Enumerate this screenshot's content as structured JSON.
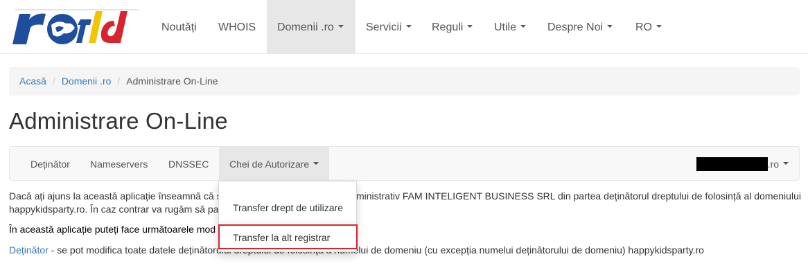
{
  "navbar": {
    "logo_text": "rotld",
    "items": [
      {
        "label": "Noutăți",
        "dropdown": false
      },
      {
        "label": "WHOIS",
        "dropdown": false
      },
      {
        "label": "Domenii .ro",
        "dropdown": true,
        "active": true
      },
      {
        "label": "Servicii",
        "dropdown": true
      },
      {
        "label": "Reguli",
        "dropdown": true
      },
      {
        "label": "Utile",
        "dropdown": true
      },
      {
        "label": "Despre Noi",
        "dropdown": true
      },
      {
        "label": "RO",
        "dropdown": true
      }
    ]
  },
  "breadcrumb": {
    "items": [
      "Acasă",
      "Domenii .ro"
    ],
    "current": "Administrare On-Line"
  },
  "page": {
    "title": "Administrare On-Line"
  },
  "subnav": {
    "items": [
      {
        "label": "Deținător"
      },
      {
        "label": "Nameservers"
      },
      {
        "label": "DNSSEC"
      },
      {
        "label": "Chei de Autorizare",
        "dropdown": true,
        "open": true
      }
    ],
    "domain_suffix": ".ro"
  },
  "content": {
    "para1_line1_a": "Dacă ați ajuns la această aplicație înseamnă că s",
    "para1_line1_b": "ministrativ FAM INTELIGENT BUSINESS SRL din partea deținătorul dreptului de folosință al domeniului",
    "para1_line2": "happykidsparty.ro. În caz contrar va rugăm să pa",
    "para2": "În această aplicație puteți face următoarele mod",
    "para3_link": "Deținător",
    "para3_text": " - se pot modifica toate datele deținătorului dreptului de folosință a numelui de domeniu (cu excepția numelui deținătorului de domeniu) happykidsparty.ro"
  },
  "dropdown": {
    "items": [
      "Transfer drept de utilizare",
      "Transfer la alt registrar"
    ]
  },
  "colors": {
    "link": "#337ab7",
    "highlight": "#d9232d",
    "nav_active_bg": "#e7e7e7"
  }
}
